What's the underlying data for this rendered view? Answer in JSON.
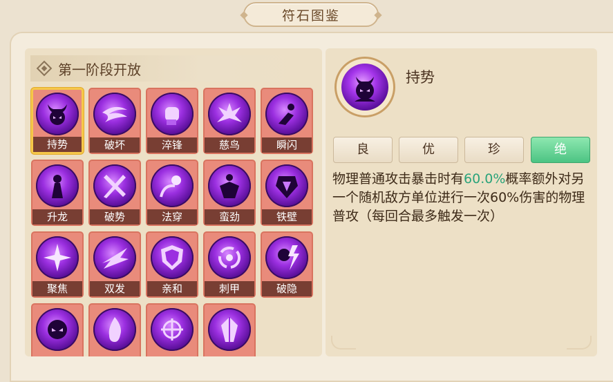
{
  "window": {
    "title": "符石图鉴"
  },
  "section": {
    "title": "第一阶段开放"
  },
  "runes": [
    {
      "name": "持势",
      "icon": "horned-demon-icon",
      "selected": true
    },
    {
      "name": "破坏",
      "icon": "swirl-wave-icon"
    },
    {
      "name": "淬锋",
      "icon": "fist-icon"
    },
    {
      "name": "慈鸟",
      "icon": "phoenix-icon"
    },
    {
      "name": "瞬闪",
      "icon": "dashing-figure-icon"
    },
    {
      "name": "升龙",
      "icon": "rising-demon-icon"
    },
    {
      "name": "破势",
      "icon": "crossed-blades-icon"
    },
    {
      "name": "法穿",
      "icon": "piercing-orb-icon"
    },
    {
      "name": "蛮劲",
      "icon": "strong-figure-icon"
    },
    {
      "name": "铁壁",
      "icon": "armor-icon"
    },
    {
      "name": "聚焦",
      "icon": "starburst-icon"
    },
    {
      "name": "双发",
      "icon": "double-strike-icon"
    },
    {
      "name": "亲和",
      "icon": "shield-icon"
    },
    {
      "name": "刺甲",
      "icon": "vortex-icon"
    },
    {
      "name": "破隐",
      "icon": "lightning-demon-icon"
    },
    {
      "name": "",
      "icon": "shadow-face-icon"
    },
    {
      "name": "",
      "icon": "flame-icon"
    },
    {
      "name": "",
      "icon": "crosshair-icon"
    },
    {
      "name": "",
      "icon": "crystal-icon"
    }
  ],
  "detail": {
    "name": "持势",
    "icon": "horned-demon-icon",
    "grades": [
      "良",
      "优",
      "珍",
      "绝"
    ],
    "active_grade": "绝",
    "desc_pre": "物理普通攻击暴击时有",
    "desc_highlight": "60.0%",
    "desc_post": "概率额外对另一个随机敌方单位进行一次60%伤害的物理普攻（每回合最多触发一次）"
  },
  "colors": {
    "highlight": "#2aa37a",
    "active_grade": "#4cc483",
    "tile": "#e98b7b",
    "selected_border": "#f6c84a"
  }
}
